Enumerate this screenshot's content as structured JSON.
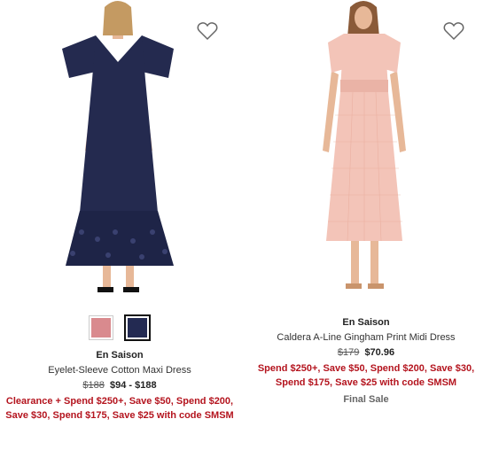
{
  "products": [
    {
      "brand": "En Saison",
      "name": "Eyelet-Sleeve Cotton Maxi Dress",
      "price_original": "$188",
      "price_current": "$94 - $188",
      "promo": "Clearance + Spend $250+, Save $50, Spend $200, Save $30, Spend $175, Save $25 with code SMSM",
      "swatches": [
        {
          "name": "pink",
          "color": "#d98a8e"
        },
        {
          "name": "navy",
          "color": "#232a52"
        }
      ],
      "dress_color": "#242a4f",
      "favorite_icon": "heart-outline-icon"
    },
    {
      "brand": "En Saison",
      "name": "Caldera A-Line Gingham Print Midi Dress",
      "price_original": "$179",
      "price_current": "$70.96",
      "promo": "Spend $250+, Save $50, Spend $200, Save $30, Spend $175, Save $25 with code SMSM",
      "note": "Final Sale",
      "dress_color": "#f3c4b8",
      "favorite_icon": "heart-outline-icon"
    }
  ],
  "colors": {
    "promo": "#b4141e"
  }
}
